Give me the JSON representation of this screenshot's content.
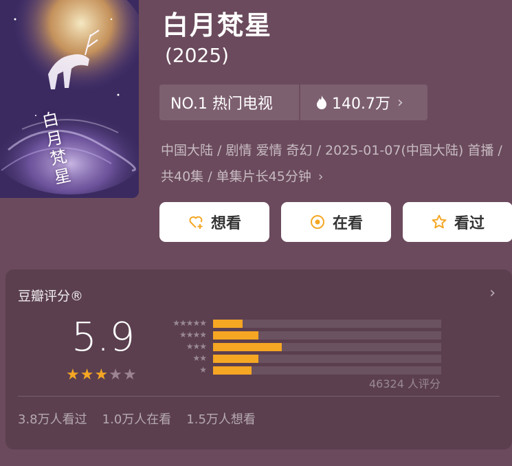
{
  "poster": {
    "title_art": "白月梵星"
  },
  "title": "白月梵星",
  "year": "(2025)",
  "rank": {
    "label": "NO.1 热门电视",
    "heat": "140.7万",
    "chevron": "›"
  },
  "meta": {
    "text": "中国大陆 / 剧情 爱情 奇幻 / 2025-01-07(中国大陆) 首播 / 共40集 / 单集片长45分钟",
    "chevron": "›"
  },
  "actions": [
    {
      "label": "想看",
      "icon": "heart-plus-icon"
    },
    {
      "label": "在看",
      "icon": "target-circle-icon"
    },
    {
      "label": "看过",
      "icon": "star-outline-icon"
    }
  ],
  "rating": {
    "title": "豆瓣评分®",
    "chevron": "›",
    "score": "5.9",
    "stars_filled": 3,
    "stars_total": 5,
    "histogram": [
      {
        "stars": "★★★★★",
        "fraction": 0.13
      },
      {
        "stars": "★★★★",
        "fraction": 0.2
      },
      {
        "stars": "★★★",
        "fraction": 0.3
      },
      {
        "stars": "★★",
        "fraction": 0.2
      },
      {
        "stars": "★",
        "fraction": 0.17
      }
    ],
    "count": "46324 人评分",
    "stats": {
      "watched": "3.8万人看过",
      "watching": "1.0万人在看",
      "want": "1.5万人想看"
    }
  },
  "colors": {
    "background": "#6b4a5d",
    "accent": "#f5a623",
    "star_empty": "#9c8492",
    "button_bg": "#ffffff"
  }
}
